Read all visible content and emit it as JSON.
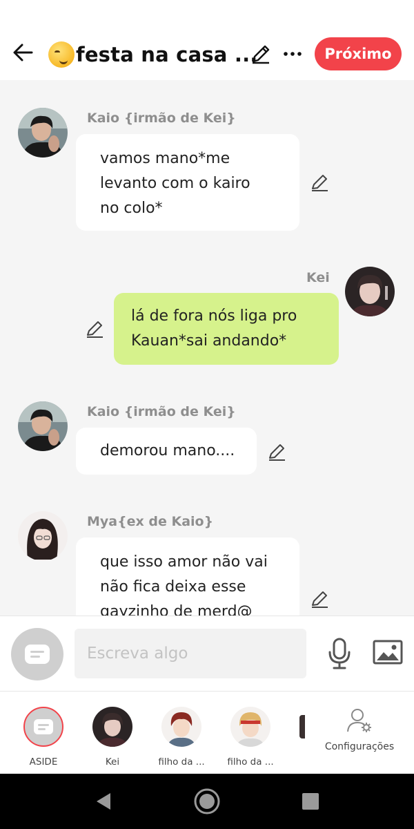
{
  "header": {
    "title": "festa na casa ...",
    "next_label": "Próximo"
  },
  "messages": [
    {
      "sender": "Kaio {irmão de Kei}",
      "lines": [
        "vamos mano*me",
        "levanto com o kairo",
        "no colo*"
      ]
    },
    {
      "sender": "Kei",
      "lines": [
        "lá de fora nós liga pro",
        "Kauan*sai andando*"
      ]
    },
    {
      "sender": "Kaio {irmão de Kei}",
      "lines": [
        "demorou mano...."
      ]
    },
    {
      "sender": "Mya{ex de Kaio}",
      "lines": [
        "que isso amor não vai",
        "não fica deixa esse",
        "gayzinho de merd@"
      ]
    }
  ],
  "input": {
    "placeholder": "Escreva algo"
  },
  "characters": [
    {
      "label": "ASIDE"
    },
    {
      "label": "Kei"
    },
    {
      "label": "filho da ..."
    },
    {
      "label": "filho da ..."
    }
  ],
  "settings": {
    "label": "Configurações"
  },
  "colors": {
    "accent": "#f2434a",
    "own_bubble": "#d6f28c",
    "other_bubble": "#ffffff",
    "sender_text": "#8e8e8e"
  }
}
